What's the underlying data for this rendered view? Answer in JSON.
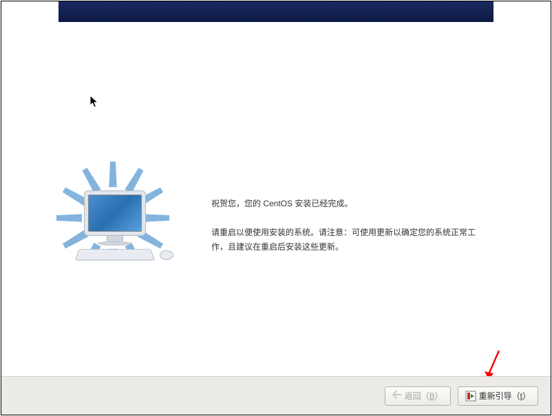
{
  "installer": {
    "congrats_line": "祝贺您，您的 CentOS 安装已经完成。",
    "instruction_line": "请重启以便使用安装的系统。请注意：可使用更新以确定您的系统正常工作，且建议在重启后安装这些更新。"
  },
  "buttons": {
    "back_label_prefix": "返回（",
    "back_mnemonic": "B",
    "back_label_suffix": "）",
    "reboot_label_prefix": "重新引导（",
    "reboot_mnemonic": "t",
    "reboot_label_suffix": "）"
  }
}
